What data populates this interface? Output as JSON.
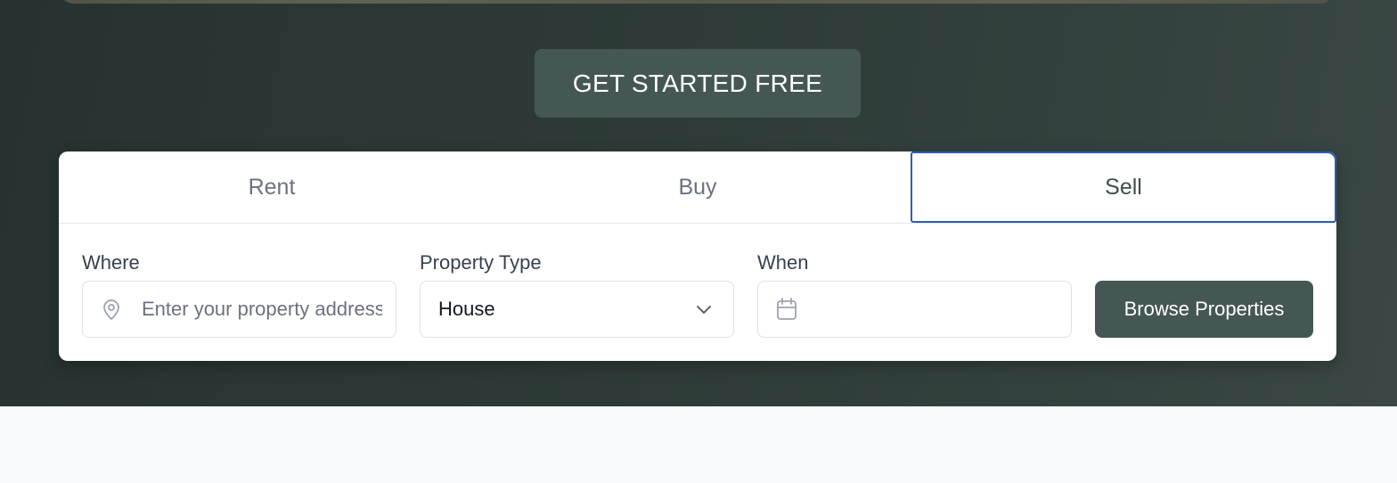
{
  "hero": {
    "cta_label": "GET STARTED FREE"
  },
  "search": {
    "tabs": [
      {
        "label": "Rent",
        "active": false
      },
      {
        "label": "Buy",
        "active": false
      },
      {
        "label": "Sell",
        "active": true
      }
    ],
    "where": {
      "label": "Where",
      "placeholder": "Enter your property address",
      "value": "",
      "icon": "map-pin-icon"
    },
    "property_type": {
      "label": "Property Type",
      "value": "House",
      "icon": "chevron-down-icon"
    },
    "when": {
      "label": "When",
      "value": "",
      "icon": "calendar-icon"
    },
    "submit_label": "Browse Properties"
  },
  "colors": {
    "hero_bg": "#2d3a37",
    "accent_button": "#455755",
    "active_tab_border": "#2b5fb8"
  }
}
